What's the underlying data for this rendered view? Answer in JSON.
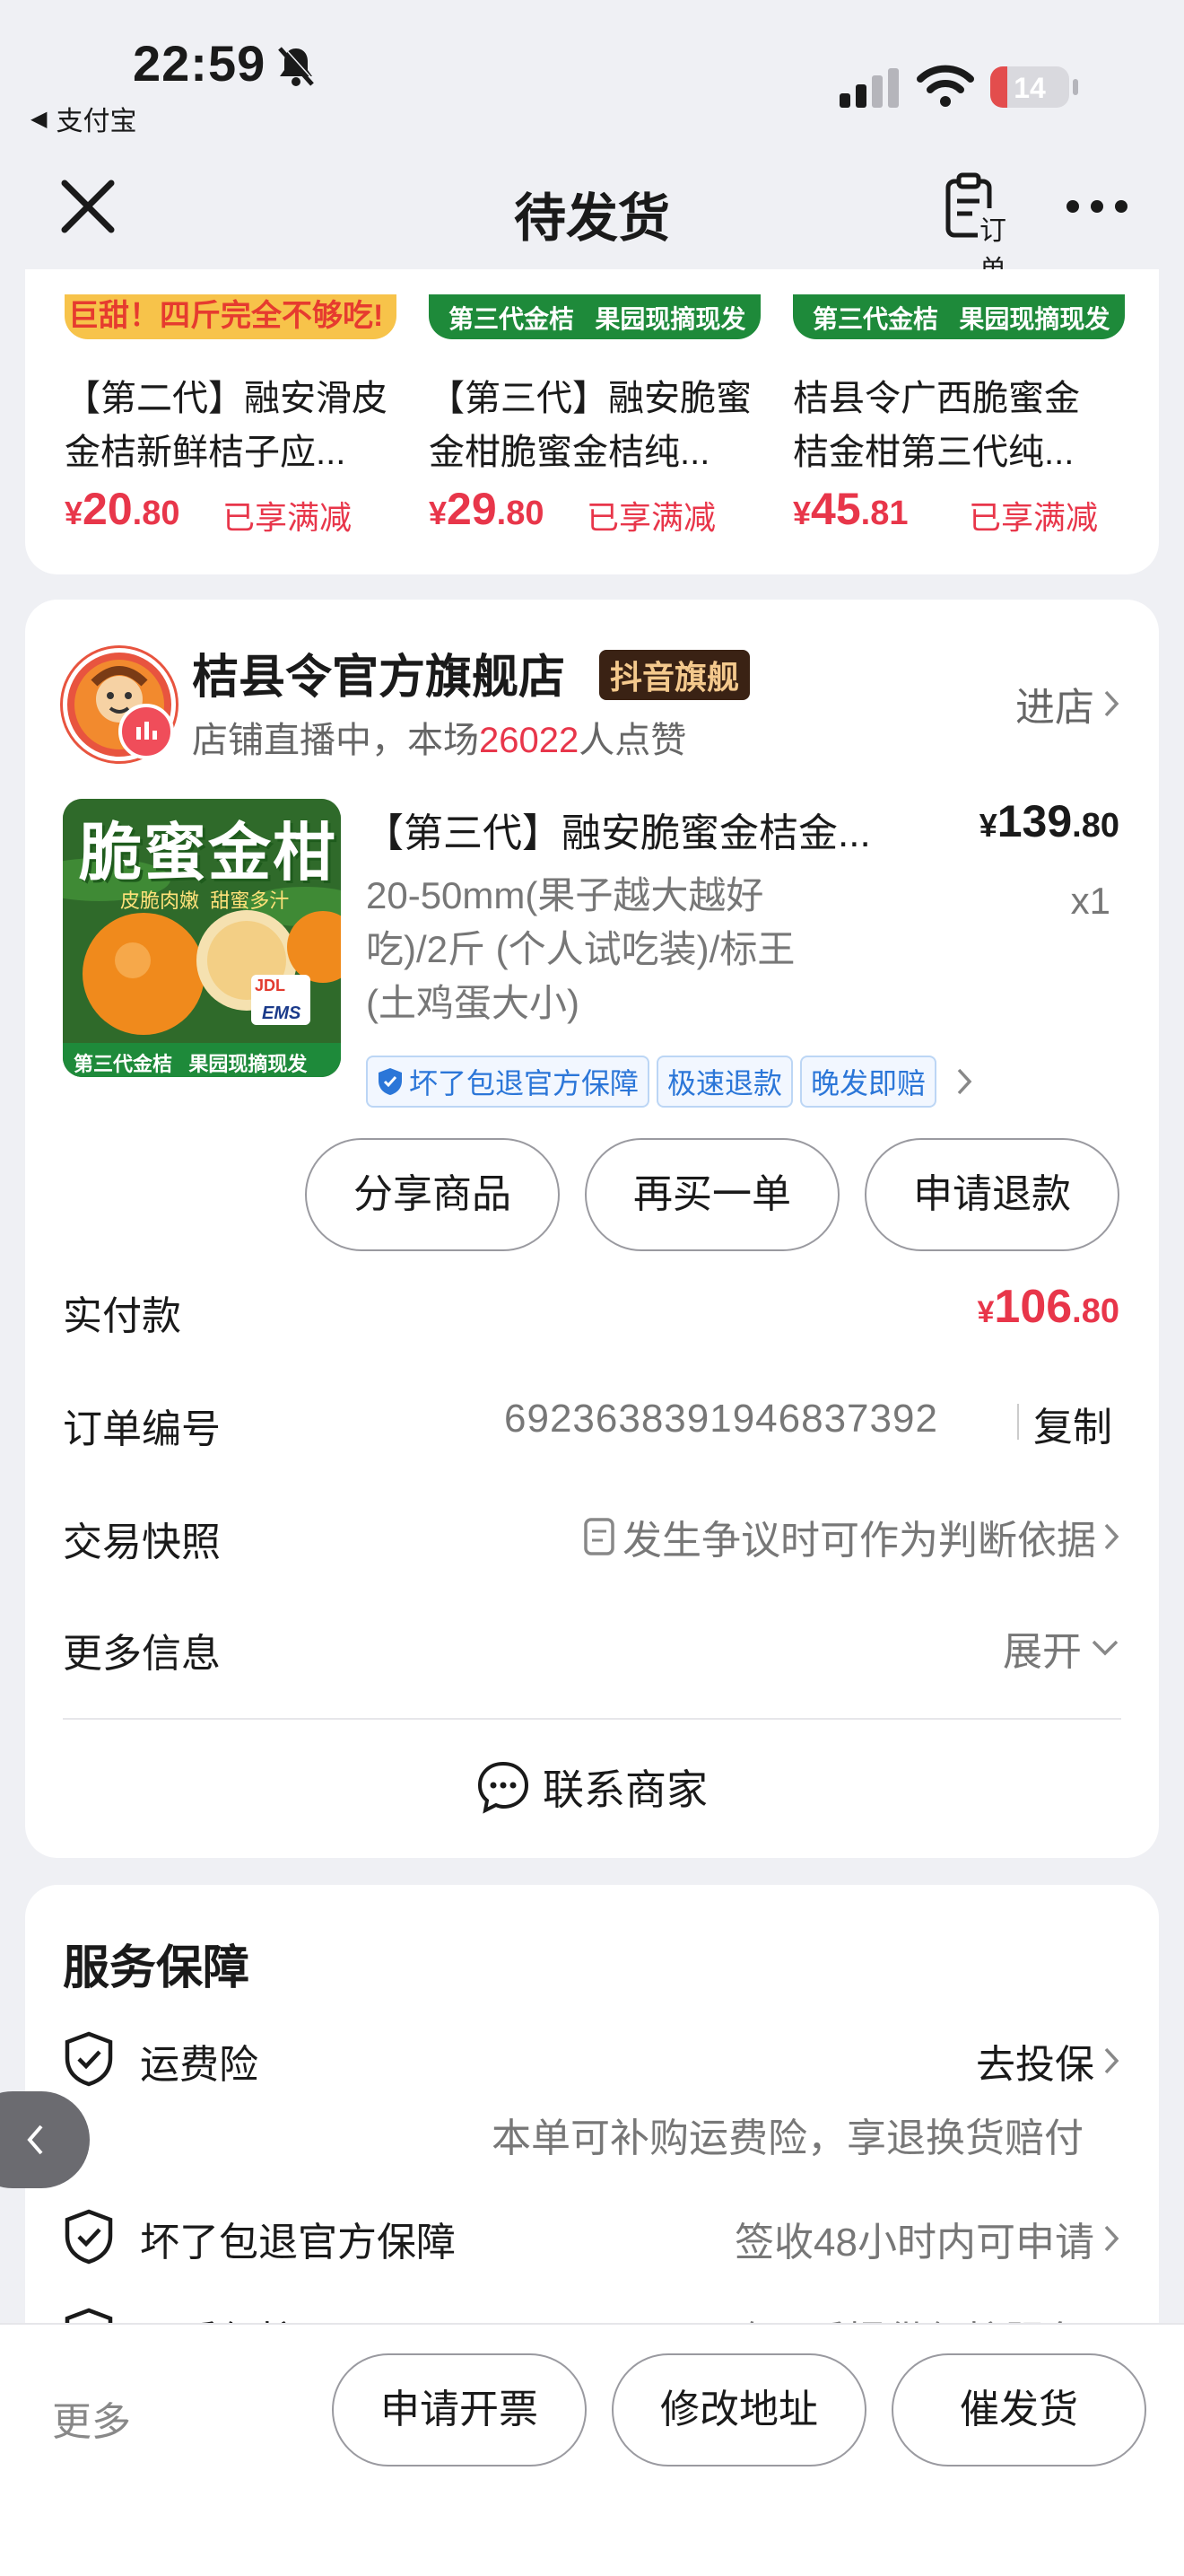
{
  "status_bar": {
    "time": "22:59",
    "back_app": "支付宝",
    "battery": "14",
    "battery_level": 0.14
  },
  "nav": {
    "title": "待发货",
    "order_label": "订单"
  },
  "recommendations": [
    {
      "banner": "巨甜！四斤完全不够吃!",
      "line1": "【第二代】融安滑皮",
      "line2": "金桔新鲜桔子应...",
      "price_int": "20",
      "price_dec": ".80",
      "promo": "已享满减"
    },
    {
      "banner": "第三代金桔   果园现摘现发",
      "line1": "【第三代】融安脆蜜",
      "line2": "金柑脆蜜金桔纯...",
      "price_int": "29",
      "price_dec": ".80",
      "promo": "已享满减"
    },
    {
      "banner": "第三代金桔   果园现摘现发",
      "line1": "桔县令广西脆蜜金",
      "line2": "桔金柑第三代纯...",
      "price_int": "45",
      "price_dec": ".81",
      "promo": "已享满减"
    }
  ],
  "currency": "¥",
  "store": {
    "name": "桔县令官方旗舰店",
    "badge": "抖音旗舰",
    "live_prefix": "店铺直播中，本场",
    "likes": "26022",
    "live_suffix": "人点赞",
    "enter": "进店"
  },
  "product": {
    "image_title": "脆蜜金柑",
    "image_sub": "皮脆肉嫩  甜蜜多汁",
    "image_banner": "第三代金桔   果园现摘现发",
    "image_ems": "EMS",
    "image_jd": "JDL",
    "title": "【第三代】融安脆蜜金桔金...",
    "price_int": "139",
    "price_dec": ".80",
    "spec_line1": "20-50mm(果子越大越好",
    "spec_line2": "吃)/2斤 (个人试吃装)/标王",
    "spec_line3": "(土鸡蛋大小)",
    "qty": "x1",
    "tags": [
      "坏了包退官方保障",
      "极速退款",
      "晚发即赔"
    ]
  },
  "actions": {
    "share": "分享商品",
    "rebuy": "再买一单",
    "refund": "申请退款"
  },
  "details": {
    "paid_label": "实付款",
    "paid_int": "106",
    "paid_dec": ".80",
    "order_no_label": "订单编号",
    "order_no": "6923638391946837392",
    "copy": "复制",
    "snapshot_label": "交易快照",
    "snapshot_value": "发生争议时可作为判断依据",
    "more_label": "更多信息",
    "expand": "展开",
    "contact": "联系商家"
  },
  "service": {
    "title": "服务保障",
    "items": [
      {
        "label": "运费险",
        "action": "去投保",
        "note": "本单可补购运费险，享退换货赔付"
      },
      {
        "label": "坏了包退官方保障",
        "action": "签收48小时内可申请"
      },
      {
        "label": "品质保护",
        "action": "购买后提供保护服务"
      }
    ]
  },
  "bottom": {
    "more": "更多",
    "invoice": "申请开票",
    "address": "修改地址",
    "urge": "催发货"
  }
}
